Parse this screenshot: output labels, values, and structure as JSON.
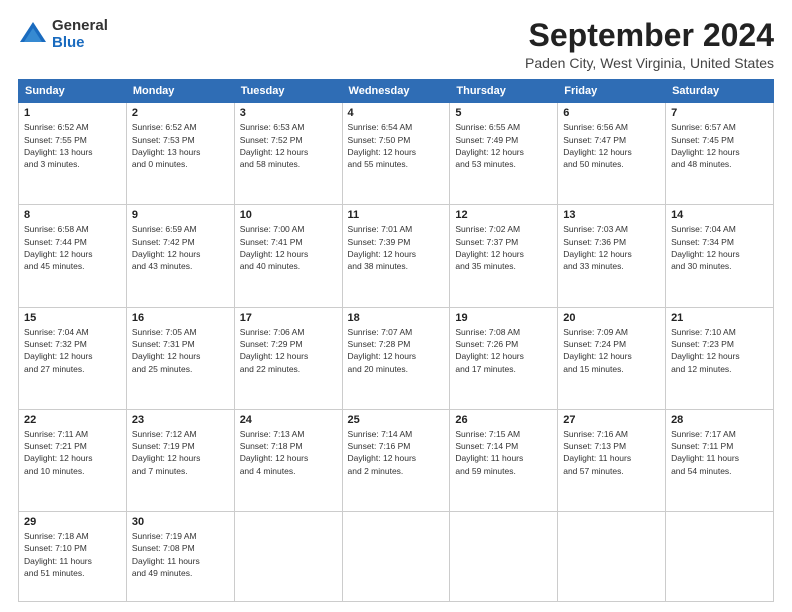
{
  "logo": {
    "general": "General",
    "blue": "Blue"
  },
  "title": "September 2024",
  "location": "Paden City, West Virginia, United States",
  "weekdays": [
    "Sunday",
    "Monday",
    "Tuesday",
    "Wednesday",
    "Thursday",
    "Friday",
    "Saturday"
  ],
  "weeks": [
    [
      {
        "day": 1,
        "info": "Sunrise: 6:52 AM\nSunset: 7:55 PM\nDaylight: 13 hours\nand 3 minutes."
      },
      {
        "day": 2,
        "info": "Sunrise: 6:52 AM\nSunset: 7:53 PM\nDaylight: 13 hours\nand 0 minutes."
      },
      {
        "day": 3,
        "info": "Sunrise: 6:53 AM\nSunset: 7:52 PM\nDaylight: 12 hours\nand 58 minutes."
      },
      {
        "day": 4,
        "info": "Sunrise: 6:54 AM\nSunset: 7:50 PM\nDaylight: 12 hours\nand 55 minutes."
      },
      {
        "day": 5,
        "info": "Sunrise: 6:55 AM\nSunset: 7:49 PM\nDaylight: 12 hours\nand 53 minutes."
      },
      {
        "day": 6,
        "info": "Sunrise: 6:56 AM\nSunset: 7:47 PM\nDaylight: 12 hours\nand 50 minutes."
      },
      {
        "day": 7,
        "info": "Sunrise: 6:57 AM\nSunset: 7:45 PM\nDaylight: 12 hours\nand 48 minutes."
      }
    ],
    [
      {
        "day": 8,
        "info": "Sunrise: 6:58 AM\nSunset: 7:44 PM\nDaylight: 12 hours\nand 45 minutes."
      },
      {
        "day": 9,
        "info": "Sunrise: 6:59 AM\nSunset: 7:42 PM\nDaylight: 12 hours\nand 43 minutes."
      },
      {
        "day": 10,
        "info": "Sunrise: 7:00 AM\nSunset: 7:41 PM\nDaylight: 12 hours\nand 40 minutes."
      },
      {
        "day": 11,
        "info": "Sunrise: 7:01 AM\nSunset: 7:39 PM\nDaylight: 12 hours\nand 38 minutes."
      },
      {
        "day": 12,
        "info": "Sunrise: 7:02 AM\nSunset: 7:37 PM\nDaylight: 12 hours\nand 35 minutes."
      },
      {
        "day": 13,
        "info": "Sunrise: 7:03 AM\nSunset: 7:36 PM\nDaylight: 12 hours\nand 33 minutes."
      },
      {
        "day": 14,
        "info": "Sunrise: 7:04 AM\nSunset: 7:34 PM\nDaylight: 12 hours\nand 30 minutes."
      }
    ],
    [
      {
        "day": 15,
        "info": "Sunrise: 7:04 AM\nSunset: 7:32 PM\nDaylight: 12 hours\nand 27 minutes."
      },
      {
        "day": 16,
        "info": "Sunrise: 7:05 AM\nSunset: 7:31 PM\nDaylight: 12 hours\nand 25 minutes."
      },
      {
        "day": 17,
        "info": "Sunrise: 7:06 AM\nSunset: 7:29 PM\nDaylight: 12 hours\nand 22 minutes."
      },
      {
        "day": 18,
        "info": "Sunrise: 7:07 AM\nSunset: 7:28 PM\nDaylight: 12 hours\nand 20 minutes."
      },
      {
        "day": 19,
        "info": "Sunrise: 7:08 AM\nSunset: 7:26 PM\nDaylight: 12 hours\nand 17 minutes."
      },
      {
        "day": 20,
        "info": "Sunrise: 7:09 AM\nSunset: 7:24 PM\nDaylight: 12 hours\nand 15 minutes."
      },
      {
        "day": 21,
        "info": "Sunrise: 7:10 AM\nSunset: 7:23 PM\nDaylight: 12 hours\nand 12 minutes."
      }
    ],
    [
      {
        "day": 22,
        "info": "Sunrise: 7:11 AM\nSunset: 7:21 PM\nDaylight: 12 hours\nand 10 minutes."
      },
      {
        "day": 23,
        "info": "Sunrise: 7:12 AM\nSunset: 7:19 PM\nDaylight: 12 hours\nand 7 minutes."
      },
      {
        "day": 24,
        "info": "Sunrise: 7:13 AM\nSunset: 7:18 PM\nDaylight: 12 hours\nand 4 minutes."
      },
      {
        "day": 25,
        "info": "Sunrise: 7:14 AM\nSunset: 7:16 PM\nDaylight: 12 hours\nand 2 minutes."
      },
      {
        "day": 26,
        "info": "Sunrise: 7:15 AM\nSunset: 7:14 PM\nDaylight: 11 hours\nand 59 minutes."
      },
      {
        "day": 27,
        "info": "Sunrise: 7:16 AM\nSunset: 7:13 PM\nDaylight: 11 hours\nand 57 minutes."
      },
      {
        "day": 28,
        "info": "Sunrise: 7:17 AM\nSunset: 7:11 PM\nDaylight: 11 hours\nand 54 minutes."
      }
    ],
    [
      {
        "day": 29,
        "info": "Sunrise: 7:18 AM\nSunset: 7:10 PM\nDaylight: 11 hours\nand 51 minutes."
      },
      {
        "day": 30,
        "info": "Sunrise: 7:19 AM\nSunset: 7:08 PM\nDaylight: 11 hours\nand 49 minutes."
      },
      null,
      null,
      null,
      null,
      null
    ]
  ]
}
